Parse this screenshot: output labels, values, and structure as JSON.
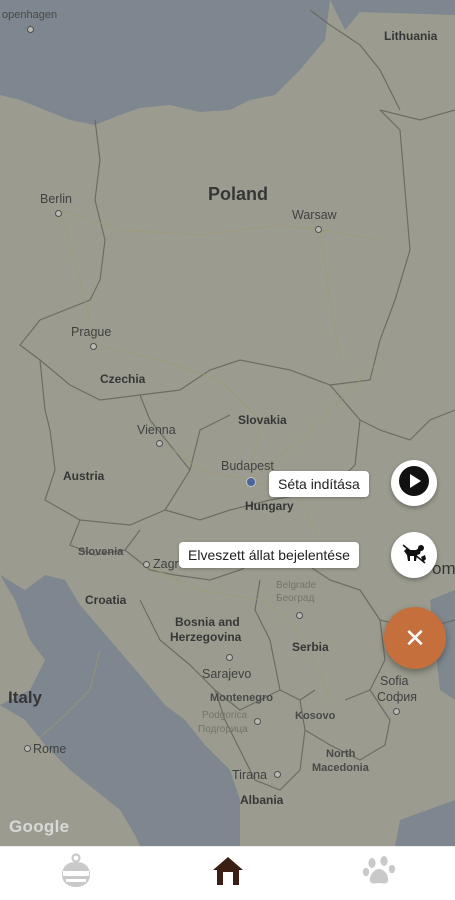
{
  "map": {
    "labels": {
      "copenhagen": "openhagen",
      "lithuania": "Lithuania",
      "poland": "Poland",
      "berlin": "Berlin",
      "warsaw": "Warsaw",
      "prague": "Prague",
      "czechia": "Czechia",
      "slovakia": "Slovakia",
      "vienna": "Vienna",
      "budapest": "Budapest",
      "austria": "Austria",
      "hungary": "Hungary",
      "slovenia": "Slovenia",
      "zagreb": "Zagreb",
      "croatia": "Croatia",
      "belgrade": "Belgrade",
      "belgrade_cyr": "Београд",
      "bosnia": "Bosnia and",
      "herzegovina": "Herzegovina",
      "serbia": "Serbia",
      "sarajevo": "Sarajevo",
      "montenegro": "Montenegro",
      "podgorica": "Podgorica",
      "podgorica_cyr": "Подгорица",
      "kosovo": "Kosovo",
      "sofia": "Sofia",
      "sofia_cyr": "София",
      "italy": "Italy",
      "rome": "Rome",
      "north_macedonia_1": "North",
      "north_macedonia_2": "Macedonia",
      "tirana": "Tirana",
      "albania": "Albania",
      "edge_right": "om"
    },
    "google_logo": "Google"
  },
  "actions": {
    "start_walk_label": "Séta indítása",
    "report_lost_label": "Elveszett állat bejelentése",
    "close_symbol": "✕"
  },
  "colors": {
    "accent": "#c46f3c",
    "nav_active": "#3b1f14",
    "nav_inactive": "#c9c9c9"
  }
}
